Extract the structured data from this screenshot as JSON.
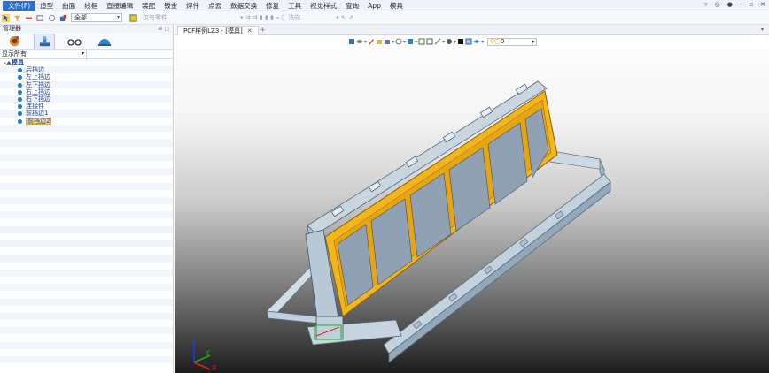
{
  "menubar": {
    "file": "文件(F)",
    "items": [
      "造型",
      "曲面",
      "线框",
      "直接编辑",
      "装配",
      "钣金",
      "焊件",
      "点云",
      "数据交换",
      "修复",
      "工具",
      "视觉样式",
      "查询",
      "App",
      "模具"
    ]
  },
  "toolbar": {
    "filter_value": "全部",
    "only_parts": "仅有零件",
    "direction": "法向"
  },
  "manager": {
    "title": "管理器",
    "filter": "显示所有"
  },
  "tree": {
    "root": "模具",
    "items": [
      "后挡边",
      "左上挡边",
      "左下挡边",
      "右上挡边",
      "右下挡边",
      "连接件",
      "前挡边1",
      "前挡边2"
    ],
    "selected_index": 7
  },
  "doc_tab": {
    "label": "PCF样例LZ3 - [模具]",
    "close": "✕",
    "new": "+"
  },
  "view_toolbar": {
    "layer_value": "0"
  },
  "colors": {
    "menu_file_bg": "#2a6fd0",
    "frame_yellow": "#f2b51c",
    "panel_blue": "#8fa1b3",
    "steel": "#c8d4df"
  },
  "icons": [
    "select-icon",
    "undo-icon",
    "cube-icon",
    "gear-icon",
    "glasses-icon",
    "helmet-icon"
  ]
}
